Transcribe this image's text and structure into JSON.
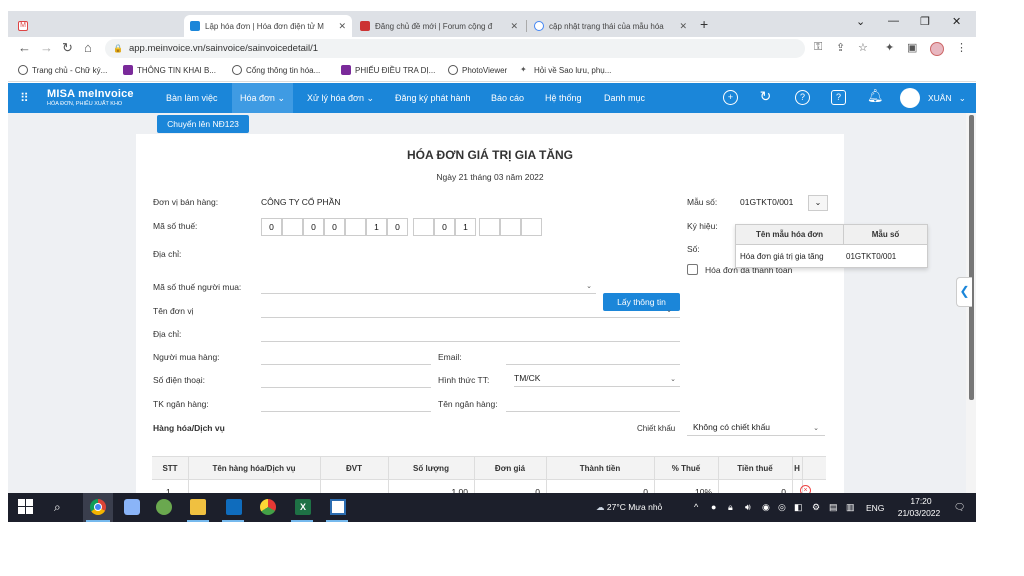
{
  "browser": {
    "tabs": [
      {
        "title": "",
        "active": false
      },
      {
        "title": "Lập hóa đơn | Hóa đơn điện tử M",
        "active": true
      },
      {
        "title": "Đăng chủ đề mới | Forum cộng đ",
        "active": false
      },
      {
        "title": "cập nhật trạng thái của mẫu hóa",
        "active": false
      }
    ],
    "url": "app.meinvoice.vn/sainvoice/sainvoicedetail/1",
    "bookmarks": [
      "Trang chủ - Chữ ký...",
      "THÔNG TIN KHAI B...",
      "Cổng thông tin hóa...",
      "PHIẾU ĐIỀU TRA DỊ...",
      "PhotoViewer",
      "Hỏi về Sao lưu, phụ..."
    ]
  },
  "app": {
    "logo_main": "MISA meInvoice",
    "logo_sub": "HÓA ĐƠN, PHIẾU XUẤT KHO",
    "menu": [
      {
        "label": "Bàn làm việc",
        "dropdown": false,
        "active": false
      },
      {
        "label": "Hóa đơn",
        "dropdown": true,
        "active": true
      },
      {
        "label": "Xử lý hóa đơn",
        "dropdown": true,
        "active": false
      },
      {
        "label": "Đăng ký phát hành",
        "dropdown": false,
        "active": false
      },
      {
        "label": "Báo cáo",
        "dropdown": false,
        "active": false
      },
      {
        "label": "Hệ thống",
        "dropdown": false,
        "active": false
      },
      {
        "label": "Danh mục",
        "dropdown": false,
        "active": false
      }
    ],
    "user": "XUÂN",
    "colors": {
      "primary": "#1b86d9",
      "active_menu": "#3f9be3",
      "delete": "#e44444"
    }
  },
  "convert_button": "Chuyển lên NĐ123",
  "invoice": {
    "title": "HÓA ĐƠN GIÁ TRỊ GIA TĂNG",
    "date": "Ngày 21 tháng 03 năm 2022",
    "seller_label": "Đơn vị bán hàng:",
    "seller_value": "CÔNG TY CỔ PHẦN",
    "tax_label": "Mã số thuế:",
    "tax_digits": [
      "0",
      "",
      "0",
      "0",
      "",
      "1",
      "0",
      "",
      "0",
      "1",
      "",
      "",
      ""
    ],
    "address_label": "Địa chỉ:",
    "buyer_tax_label": "Mã số thuế người mua:",
    "lookup_button": "Lấy thông tin",
    "unit_label": "Tên đơn vị",
    "address2_label": "Địa chỉ:",
    "buyer_label": "Người mua hàng:",
    "email_label": "Email:",
    "phone_label": "Số điện thoại:",
    "payment_label": "Hình thức TT:",
    "payment_value": "TM/CK",
    "bank_account_label": "TK ngân hàng:",
    "bank_name_label": "Tên ngân hàng:",
    "goods_label": "Hàng hóa/Dịch vụ",
    "discount_label": "Chiết khấu",
    "discount_value": "Không có chiết khấu",
    "template_label": "Mẫu số:",
    "template_value": "01GTKT0/001",
    "symbol_label": "Ký hiệu:",
    "number_label": "Số:",
    "paid_label": "Hóa đơn đã thanh toán",
    "paid_checked": false
  },
  "template_popup": {
    "headers": [
      "Tên mẫu hóa đơn",
      "Mẫu số"
    ],
    "row": [
      "Hóa đơn giá trị gia tăng",
      "01GTKT0/001"
    ]
  },
  "table": {
    "headers": [
      "STT",
      "Tên hàng hóa/Dịch vụ",
      "ĐVT",
      "Số lượng",
      "Đơn giá",
      "Thành tiền",
      "% Thuế",
      "Tiền thuế",
      "H"
    ],
    "rows": [
      {
        "stt": "1",
        "name": "",
        "unit": "",
        "qty": "1,00",
        "price": "0",
        "amount": "0",
        "tax_rate": "10%",
        "tax": "0"
      }
    ]
  },
  "taskbar": {
    "weather": "27°C  Mưa nhỏ",
    "language": "ENG",
    "time": "17:20",
    "date": "21/03/2022"
  }
}
